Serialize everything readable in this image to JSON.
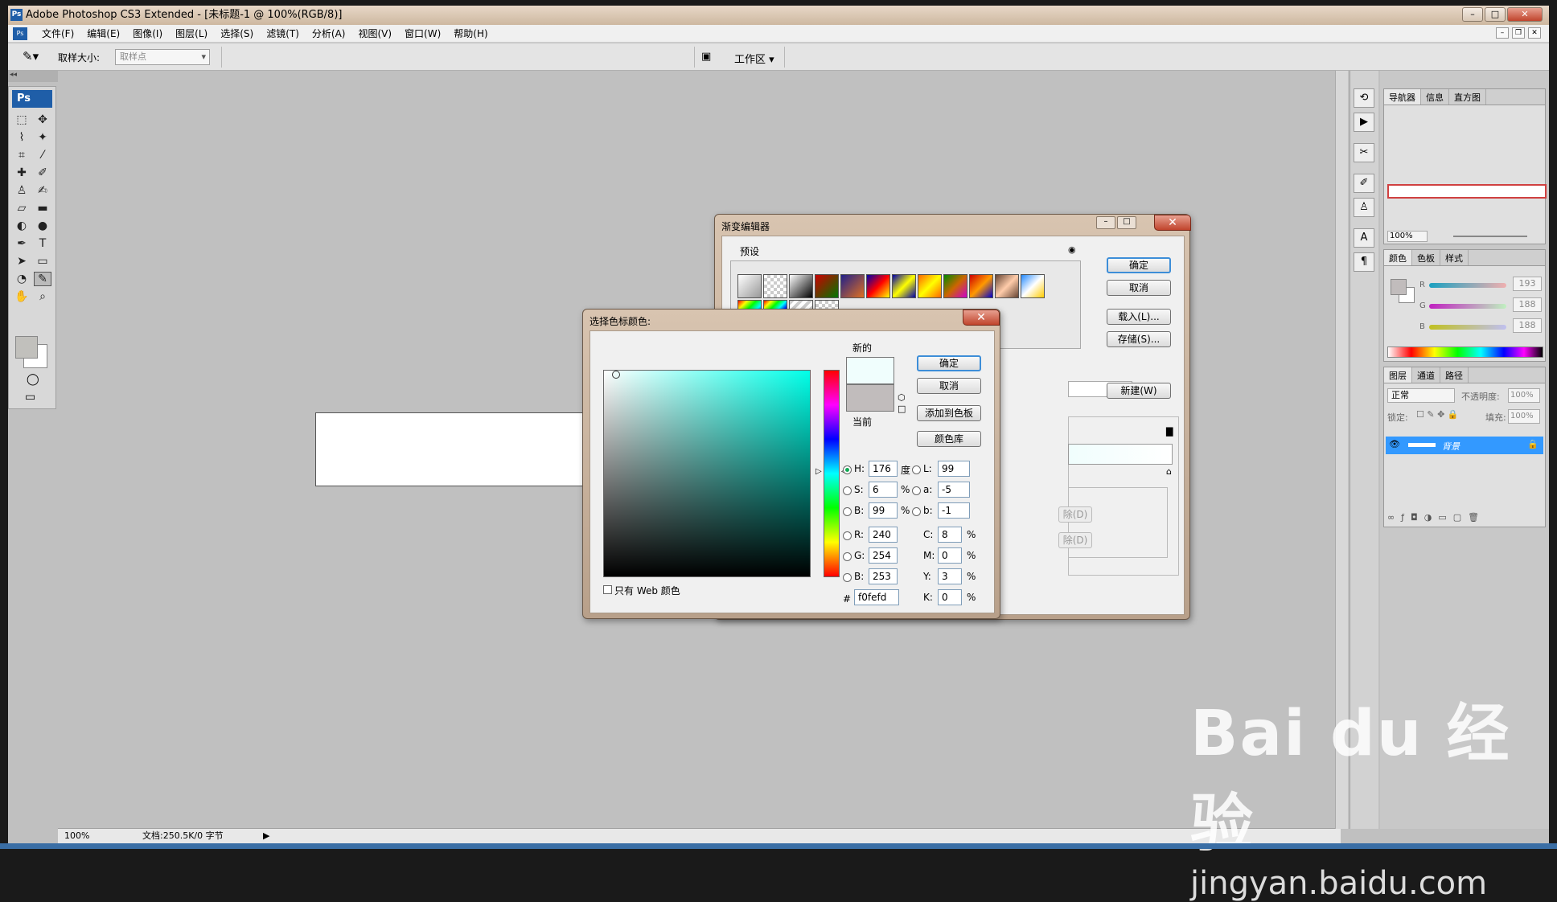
{
  "window": {
    "title": "Adobe Photoshop CS3 Extended - [未标题-1 @ 100%(RGB/8)]",
    "min": "–",
    "max": "□",
    "close": "✕"
  },
  "menu": [
    "文件(F)",
    "编辑(E)",
    "图像(I)",
    "图层(L)",
    "选择(S)",
    "滤镜(T)",
    "分析(A)",
    "视图(V)",
    "窗口(W)",
    "帮助(H)"
  ],
  "options": {
    "sample_size_label": "取样大小:",
    "sample_size_value": "取样点",
    "workspace": "工作区 ▾"
  },
  "toolbox": {
    "logo": "Ps"
  },
  "status": {
    "zoom": "100%",
    "doc": "文档:250.5K/0 字节"
  },
  "panels": {
    "nav_tabs": [
      "导航器",
      "信息",
      "直方图"
    ],
    "nav_zoom": "100%",
    "color_tabs": [
      "颜色",
      "色板",
      "样式"
    ],
    "channels": [
      {
        "label": "R",
        "value": "193"
      },
      {
        "label": "G",
        "value": "188"
      },
      {
        "label": "B",
        "value": "188"
      }
    ],
    "layer_tabs": [
      "图层",
      "通道",
      "路径"
    ],
    "blend_mode": "正常",
    "opacity_label": "不透明度:",
    "opacity_value": "100%",
    "lock_label": "锁定:",
    "fill_label": "填充:",
    "fill_value": "100%",
    "layer_name": "背景"
  },
  "gradient_editor": {
    "title": "渐变编辑器",
    "presets_label": "预设",
    "ok": "确定",
    "cancel": "取消",
    "load": "载入(L)...",
    "save": "存储(S)...",
    "new": "新建(W)",
    "delete1": "除(D)",
    "delete2": "除(D)"
  },
  "color_picker": {
    "title": "选择色标颜色:",
    "new_label": "新的",
    "current_label": "当前",
    "ok": "确定",
    "cancel": "取消",
    "add_swatch": "添加到色板",
    "libraries": "颜色库",
    "web_only": "只有 Web 颜色",
    "new_color": "#f0fefd",
    "current_color": "#c1bcbc",
    "H": "176",
    "S": "6",
    "Bv": "99",
    "R": "240",
    "G": "254",
    "B": "253",
    "L": "99",
    "a": "-5",
    "b": "-1",
    "C": "8",
    "M": "0",
    "Y": "3",
    "K": "0",
    "hex": "f0fefd",
    "deg": "度",
    "pct": "%"
  },
  "watermark": {
    "brand": "Bai du 经验",
    "url": "jingyan.baidu.com"
  }
}
